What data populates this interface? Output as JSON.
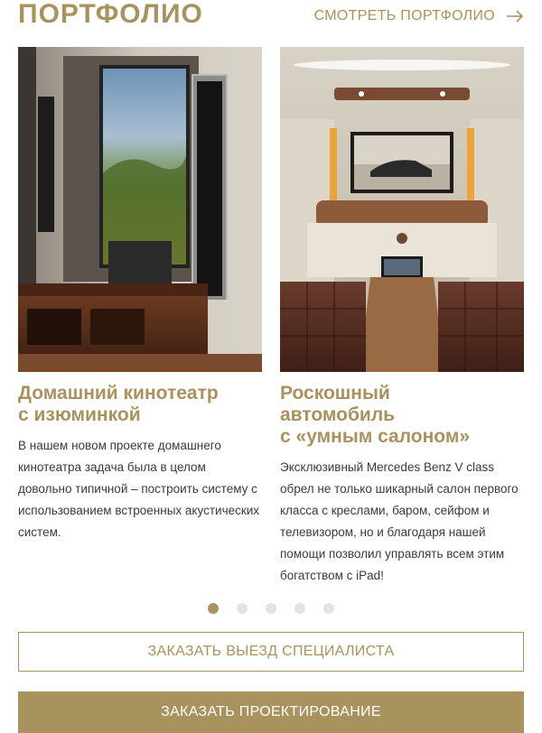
{
  "header": {
    "title": "ПОРТФОЛИО",
    "link_label": "СМОТРЕТЬ ПОРТФОЛИО",
    "link_icon": "arrow-right-icon"
  },
  "cards": [
    {
      "title_line1": "Домашний кинотеатр",
      "title_line2": "с изюминкой",
      "text": "В нашем новом проекте домашнего кинотеатра задача была в целом довольно типичной – построить систему с использованием встроенных акустических систем."
    },
    {
      "title_line1": "Роскошный",
      "title_line2": "автомобиль",
      "title_line3": "с «умным салоном»",
      "text": "Эксклюзивный Mercedes Benz V class обрел не только шикарный салон первого класса с креслами, баром, сейфом и телевизором, но и благодаря нашей помощи позволил управлять всем этим богатством с iPad!"
    }
  ],
  "pagination": {
    "count": 5,
    "active_index": 0
  },
  "buttons": {
    "order_visit": "ЗАКАЗАТЬ ВЫЕЗД СПЕЦИАЛИСТА",
    "order_design": "ЗАКАЗАТЬ ПРОЕКТИРОВАНИЕ"
  },
  "colors": {
    "accent": "#a8925e",
    "text": "#3a3a3a",
    "dot_inactive": "#e3e3e3"
  }
}
